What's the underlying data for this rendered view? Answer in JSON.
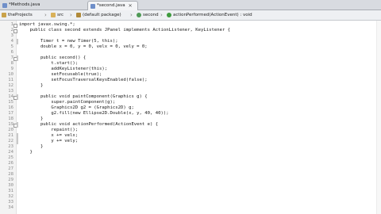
{
  "tabs": [
    {
      "label": "*Methods.java",
      "active": false
    },
    {
      "label": "*second.java",
      "active": true,
      "close": "✕"
    }
  ],
  "breadcrumb": [
    {
      "label": "theProjects",
      "icon": "project-icon"
    },
    {
      "label": "src",
      "icon": "folder-icon"
    },
    {
      "label": "(default package)",
      "icon": "package-icon"
    },
    {
      "label": "second",
      "icon": "class-icon"
    },
    {
      "label": "actionPerformed(ActionEvent) : void",
      "icon": "method-icon"
    }
  ],
  "separator": "›",
  "editor": {
    "lines": [
      {
        "n": "1",
        "text": "import javax.swing.*;"
      },
      {
        "n": "2",
        "text": "    public class second extends JPanel implements ActionListener, KeyListener {"
      },
      {
        "n": "3",
        "text": ""
      },
      {
        "n": "4",
        "text": "        Timer t = new Timer(5, this);"
      },
      {
        "n": "5",
        "text": "        double x = 0, y = 0, velx = 0, vely = 0;"
      },
      {
        "n": "6",
        "text": ""
      },
      {
        "n": "7",
        "text": "        public second() {"
      },
      {
        "n": "8",
        "text": "            t.start();"
      },
      {
        "n": "9",
        "text": "            addKeyListener(this);"
      },
      {
        "n": "10",
        "text": "            setFocusable(true);"
      },
      {
        "n": "11",
        "text": "            setFocusTraversalKeysEnabled(false);"
      },
      {
        "n": "12",
        "text": "        }"
      },
      {
        "n": "13",
        "text": ""
      },
      {
        "n": "14",
        "text": "        public void paintComponent(Graphics g) {"
      },
      {
        "n": "15",
        "text": "            super.paintComponent(g);"
      },
      {
        "n": "16",
        "text": "            Graphics2D g2 = (Graphics2D) g;"
      },
      {
        "n": "17",
        "text": "            g2.fill(new Ellipse2D.Double(x, y, 40, 40));"
      },
      {
        "n": "18",
        "text": "        }"
      },
      {
        "n": "19",
        "text": "        public void actionPerformed(ActionEvent e) {"
      },
      {
        "n": "20",
        "text": "            repaint();"
      },
      {
        "n": "21",
        "text": "            x += velx;"
      },
      {
        "n": "22",
        "text": "            y += vely;"
      },
      {
        "n": "23",
        "text": "        }"
      },
      {
        "n": "24",
        "text": "    }"
      },
      {
        "n": "25",
        "text": ""
      },
      {
        "n": "26",
        "text": ""
      },
      {
        "n": "27",
        "text": ""
      },
      {
        "n": "28",
        "text": ""
      },
      {
        "n": "29",
        "text": ""
      },
      {
        "n": "30",
        "text": ""
      },
      {
        "n": "31",
        "text": ""
      },
      {
        "n": "32",
        "text": ""
      },
      {
        "n": "33",
        "text": ""
      },
      {
        "n": "34",
        "text": ""
      }
    ]
  }
}
